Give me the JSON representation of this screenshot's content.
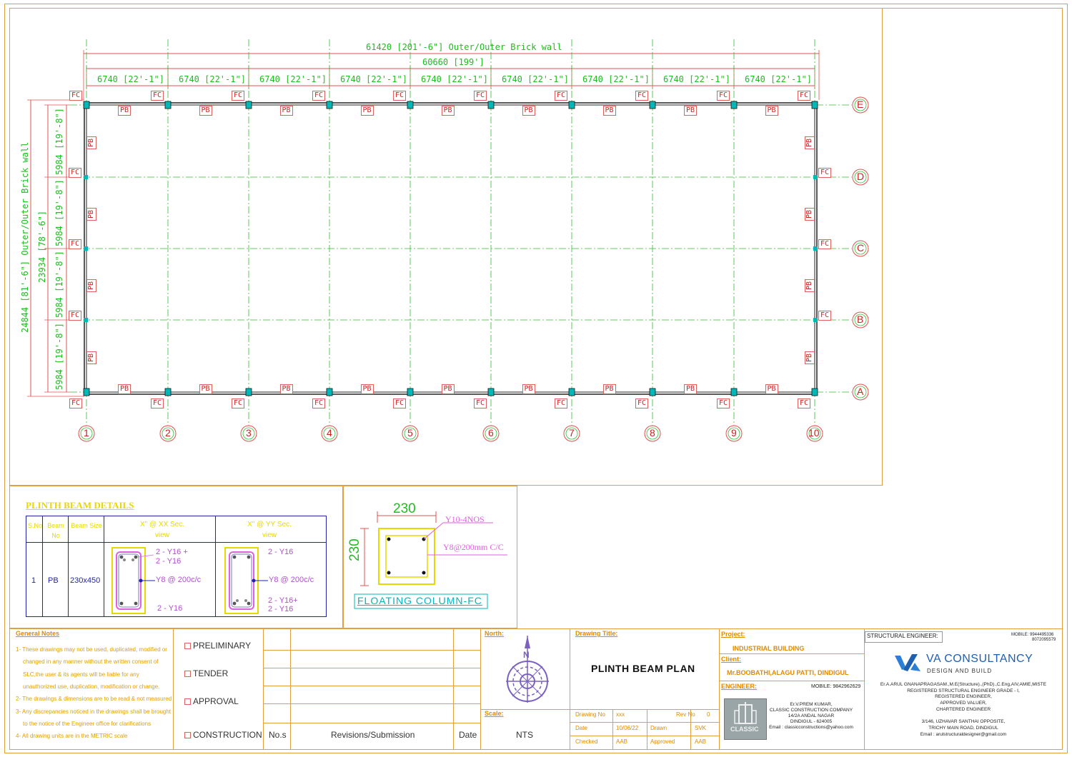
{
  "plan": {
    "overall_length": "61420 [201'-6\"] Outer/Outer Brick wall",
    "grid_length": "60660 [199']",
    "bay_label": "6740 [22'-1\"]",
    "bay_count": 9,
    "overall_width": "24844 [81'-6\"] Outer/Outer Brick wall",
    "grid_width": "23934 [78'-6\"]",
    "row_bay_label": "5984 [19'-8\"]",
    "column_grids": [
      "1",
      "2",
      "3",
      "4",
      "5",
      "6",
      "7",
      "8",
      "9",
      "10"
    ],
    "row_grids": [
      "E",
      "D",
      "C",
      "B",
      "A"
    ],
    "column_tag": "FC",
    "beam_tag": "PB"
  },
  "plinth_details": {
    "title": "PLINTH BEAM DETAILS",
    "headers": [
      "S.No",
      "Beam No",
      "Beam Size",
      "X\" @ XX Sec. view",
      "X\" @ YY Sec. view"
    ],
    "row": {
      "sno": "1",
      "beam_no": "PB",
      "beam_size": "230x450",
      "sec1_top": "2 - Y16 +",
      "sec1_top2": "2 - Y16",
      "sec1_stirrup": "Y8 @ 200c/c",
      "sec1_bottom": "2 - Y16",
      "sec2_top": "2 - Y16",
      "sec2_stirrup": "Y8 @ 200c/c",
      "sec2_bottom": "2 - Y16+",
      "sec2_bottom2": "2 - Y16"
    }
  },
  "floating_column": {
    "width": "230",
    "depth": "230",
    "main_bars": "Y10-4NOS",
    "ties": "Y8@200mm C/C",
    "title": "FLOATING COLUMN-FC"
  },
  "title_block": {
    "general_notes_title": "General Notes",
    "notes": [
      "1- These drawings may not be used, duplicated, modified or",
      "changed in any manner without the written consent of",
      "SLC,the user & its agents will be liable for any",
      "unauthorized use, duplication, modification or change.",
      "2- The drawings & dimensions are to be read & not measured",
      "3- Any discrepancies noticed in the drawings shall be brought",
      "to the notice of the Engineer office for clarifications",
      "4- All drawing units are in the METRIC scale"
    ],
    "stages": [
      "PRELIMINARY",
      "TENDER",
      "APPROVAL",
      "CONSTRUCTION"
    ],
    "revision_headers": {
      "no": "No.s",
      "rev": "Revisions/Submission",
      "date": "Date"
    },
    "north_label": "North:",
    "north_letter": "N",
    "scale_label": "Scale:",
    "scale_value": "NTS",
    "drawing_title_label": "Drawing Title:",
    "drawing_title": "PLINTH BEAM PLAN",
    "drawing_no_label": "Drawing No",
    "drawing_no": "xxx",
    "rev_no_label": "Rev No",
    "rev_no": "0",
    "date_label": "Date",
    "date_value": "10/06/22",
    "drawn_label": "Drawn",
    "drawn_value": "SVK",
    "checked_label": "Checked",
    "checked_value": "AAB",
    "approved_label": "Approved",
    "approved_value": "AAB",
    "project_label": "Project:",
    "project_value": "INDUSTRIAL BUILDING",
    "client_label": "Client:",
    "client_value": "Mr.BOOBATHI,ALAGU PATTI, DINDIGUL",
    "engineer_label": "ENGINEER:",
    "engineer_mobile": "MOBILE: 9842962629",
    "engineer_lines": [
      "Er.V.PREM KUMAR,",
      "CLASSIC CONSTRUCTION COMPANY",
      "14/2A ANDAL NAGAR",
      "DINDIGUL - 624005",
      "Email : classicconstructions@yahoo.com"
    ],
    "classic_logo_text": "CLASSIC",
    "structural_engineer_label": "STRUCTURAL ENGINEER:",
    "se_mobile_1": "MOBILE: 9944495336",
    "se_mobile_2": "8072095579",
    "consultancy_name": "VA CONSULTANCY",
    "consultancy_tag": "DESIGN AND BUILD",
    "se_lines": [
      "Er.A.ARUL GNANAPRAGASAM.,M.E(Structure).,(PhD).,C.Eng,AIV,AMIE,MISTE",
      "REGISTERED STRUCTURAL ENGINEER GRADE - I,",
      "REGISTERED ENGINEER,",
      "APPROVED VALUER,",
      "CHARTERED ENGINEER",
      "",
      "3/146, UZHAVAR SANTHAI OPPOSITE,",
      "TRICHY MAIN ROAD, DINDIGUL",
      "Email : arulstructuraldesigner@gmail.com"
    ]
  },
  "colors": {
    "dimension_green": "#22bb22",
    "dimension_red": "#e05050",
    "grid_green": "#33bb33",
    "tag_red": "#cc2222",
    "column_cyan": "#00b8b8",
    "frame_orange": "#e0a040",
    "detail_blue": "#2222aa"
  }
}
